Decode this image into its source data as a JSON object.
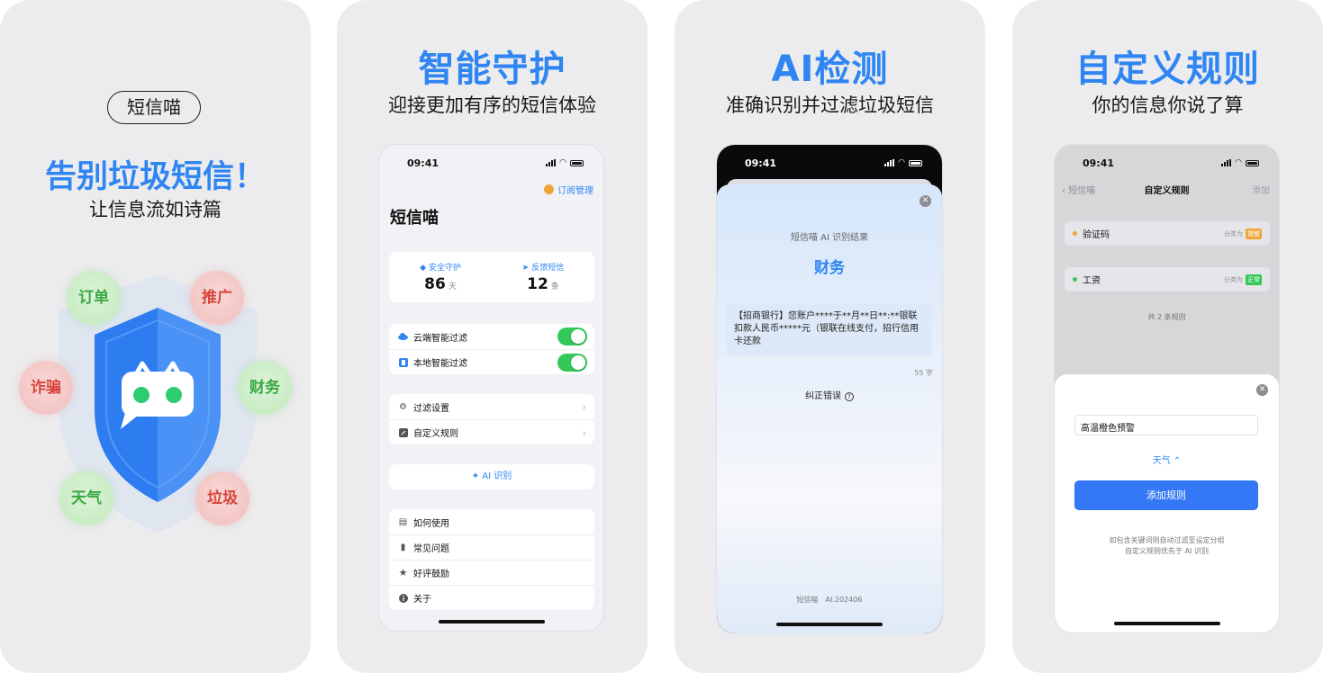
{
  "panel1": {
    "brand": "短信喵",
    "headline": "告别垃圾短信！",
    "subline": "让信息流如诗篇",
    "bubbles": {
      "order": "订单",
      "promo": "推广",
      "fraud": "诈骗",
      "finance": "财务",
      "weather": "天气",
      "spam": "垃圾"
    },
    "colors": {
      "accent": "#2f86f2",
      "shield": "#2d7cf0",
      "green": "#3ba844",
      "red": "#d9443c"
    }
  },
  "panel2": {
    "title": "智能守护",
    "subtitle": "迎接更加有序的短信体验",
    "phone": {
      "time": "09:41",
      "subscription": "订阅管理",
      "app_title": "短信喵",
      "stats": [
        {
          "label": "安全守护",
          "value": "86",
          "unit": "天"
        },
        {
          "label": "反馈短信",
          "value": "12",
          "unit": "条"
        }
      ],
      "filters": [
        {
          "label": "云端智能过滤",
          "on": true
        },
        {
          "label": "本地智能过滤",
          "on": true
        }
      ],
      "settings": [
        "过滤设置",
        "自定义规则"
      ],
      "ai_button": "AI 识别",
      "help": [
        "如何使用",
        "常见问题",
        "好评鼓励",
        "关于"
      ]
    }
  },
  "panel3": {
    "title": "AI检测",
    "subtitle": "准确识别并过滤垃圾短信",
    "phone": {
      "time": "09:41",
      "result_title": "短信喵 AI 识别结果",
      "category": "财务",
      "message": "【招商银行】您账户****于**月**日**:**银联扣款人民币*****元（银联在线支付，招行信用卡还款",
      "char_count": "55 字",
      "correct": "纠正错误",
      "footer": "短信喵　AI.202406"
    }
  },
  "panel4": {
    "title": "自定义规则",
    "subtitle": "你的信息你说了算",
    "phone": {
      "time": "09:41",
      "back": "短信喵",
      "nav_title": "自定义规则",
      "add": "添加",
      "rules": [
        {
          "keyword": "验证码",
          "classify": "分类为",
          "tag": "提醒",
          "color": "#f0a43a"
        },
        {
          "keyword": "工资",
          "classify": "分类为",
          "tag": "正常",
          "color": "#34c759"
        }
      ],
      "total": "共 2 条规则",
      "input_value": "高温橙色预警",
      "category": "天气 ⌃",
      "add_button": "添加规则",
      "hint_line1": "如包含关键词则自动过滤至设定分组",
      "hint_line2": "自定义规则优先于 AI 识别"
    }
  }
}
